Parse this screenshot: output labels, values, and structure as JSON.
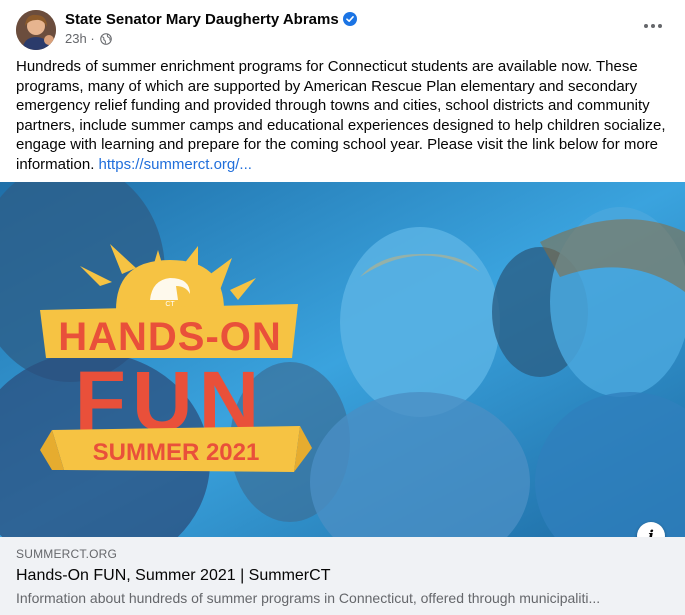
{
  "post": {
    "author": "State Senator Mary Daugherty Abrams",
    "time": "23h",
    "separator": "·",
    "text": "Hundreds of summer enrichment programs for Connecticut students are available now. These programs, many of which are supported by American Rescue Plan elementary and secondary emergency relief funding and provided through towns and cities, school districts and community partners, include summer camps and educational experiences designed to help children socialize, engage with learning and prepare for the coming school year. Please visit the link below for more information.",
    "link_text": "https://summerct.org/..."
  },
  "image": {
    "logo_line1": "HANDS-ON",
    "logo_line2": "FUN",
    "logo_line3": "SUMMER 2021",
    "sun_text": "CT"
  },
  "link_card": {
    "domain": "SUMMERCT.ORG",
    "title": "Hands-On FUN, Summer 2021 | SummerCT",
    "description": "Information about hundreds of summer programs in Connecticut, offered through municipaliti..."
  },
  "colors": {
    "accent_link": "#216fdb",
    "verified_blue": "#1b74e4",
    "logo_yellow": "#f6c343",
    "logo_red": "#e9503a",
    "photo_blue": "#2a8fc9"
  },
  "icons": {
    "verified": "verified-badge-icon",
    "globe": "globe-icon",
    "more": "more-options-icon",
    "info": "info-icon"
  },
  "info_glyph": "i"
}
